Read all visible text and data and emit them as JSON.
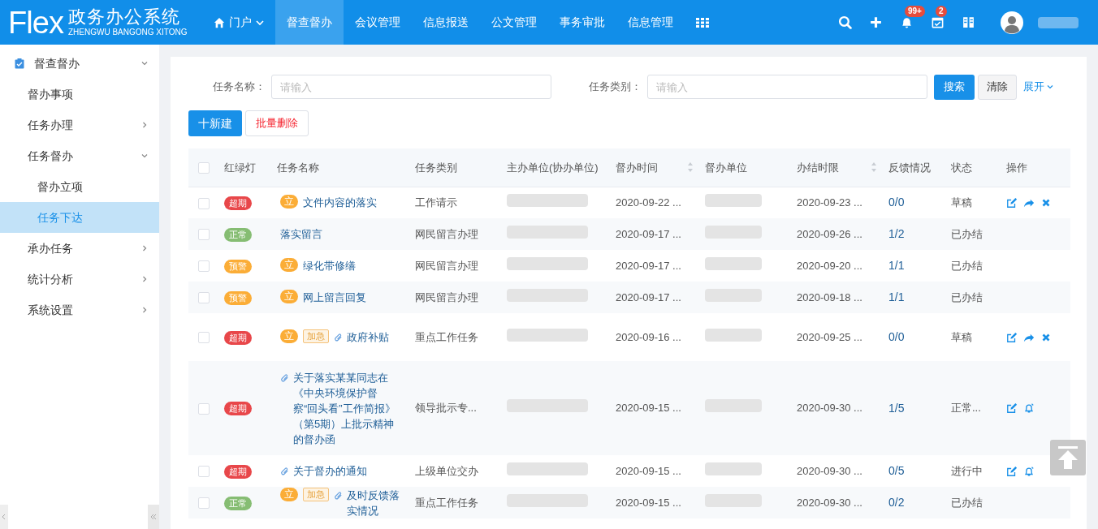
{
  "header": {
    "logo": "Flex",
    "app_title": "政务办公系统",
    "app_subtitle": "ZHENGWU BANGONG XITONG",
    "nav": [
      {
        "label": "门户",
        "kind": "home",
        "selected": false
      },
      {
        "label": "督查督办",
        "kind": "plain",
        "selected": true
      },
      {
        "label": "会议管理",
        "kind": "plain",
        "selected": false
      },
      {
        "label": "信息报送",
        "kind": "plain",
        "selected": false
      },
      {
        "label": "公文管理",
        "kind": "plain",
        "selected": false
      },
      {
        "label": "事务审批",
        "kind": "plain",
        "selected": false
      },
      {
        "label": "信息管理",
        "kind": "plain",
        "selected": false
      },
      {
        "kind": "grid",
        "selected": false
      }
    ],
    "tools": [
      {
        "kind": "search"
      },
      {
        "kind": "plus"
      },
      {
        "kind": "bell",
        "badge": "99+"
      },
      {
        "kind": "calendar",
        "badge": "2"
      },
      {
        "kind": "book"
      }
    ]
  },
  "sidebar": {
    "items": [
      {
        "label": "督查督办",
        "kind": "section",
        "expanded": true,
        "selected": false,
        "children": [
          {
            "label": "督办事项",
            "kind": "leaf",
            "selected": false
          },
          {
            "label": "任务办理",
            "kind": "group",
            "expanded": false,
            "selected": false
          },
          {
            "label": "任务督办",
            "kind": "group",
            "expanded": true,
            "selected": false,
            "children": [
              {
                "label": "督办立项",
                "kind": "leaf",
                "selected": false
              },
              {
                "label": "任务下达",
                "kind": "leaf",
                "selected": true
              }
            ]
          },
          {
            "label": "承办任务",
            "kind": "group",
            "expanded": false,
            "selected": false
          },
          {
            "label": "统计分析",
            "kind": "group",
            "expanded": false,
            "selected": false
          },
          {
            "label": "系统设置",
            "kind": "group",
            "expanded": false,
            "selected": false
          }
        ]
      }
    ]
  },
  "filters": [
    {
      "label": "任务名称：",
      "placeholder": "请输入"
    },
    {
      "label": "任务类别：",
      "placeholder": "请输入"
    }
  ],
  "filter_buttons": {
    "search": "搜索",
    "clear": "清除",
    "expand": "展开"
  },
  "actions": {
    "create": "十新建",
    "batch_delete": "批量删除"
  },
  "table": {
    "all_checked": false,
    "columns": [
      {
        "label": "红绿灯",
        "sortable": false
      },
      {
        "label": "任务名称",
        "sortable": false
      },
      {
        "label": "任务类别",
        "sortable": false
      },
      {
        "label": "主办单位(协办单位)",
        "sortable": false
      },
      {
        "label": "督办时间",
        "sortable": true
      },
      {
        "label": "督办单位",
        "sortable": false
      },
      {
        "label": "办结时限",
        "sortable": true
      },
      {
        "label": "反馈情况",
        "sortable": false
      },
      {
        "label": "状态",
        "sortable": false
      },
      {
        "label": "操作",
        "sortable": false
      }
    ],
    "rows": [
      {
        "checked": false,
        "light": {
          "kind": "overdue",
          "label": "超期"
        },
        "tag": "立",
        "urgent": null,
        "attachment": false,
        "name": "文件内容的落实",
        "category": "工作请示",
        "start": "2020-09-22 ...",
        "deadline": "2020-09-23 ...",
        "feedback": "0/0",
        "status": "草稿",
        "actions": [
          {
            "kind": "edit"
          },
          {
            "kind": "forward"
          },
          {
            "kind": "delete"
          }
        ]
      },
      {
        "checked": false,
        "light": {
          "kind": "normal",
          "label": "正常"
        },
        "tag": null,
        "urgent": null,
        "attachment": false,
        "name": "落实留言",
        "category": "网民留言办理",
        "start": "2020-09-17 ...",
        "deadline": "2020-09-26 ...",
        "feedback": "1/2",
        "status": "已办结",
        "actions": []
      },
      {
        "checked": false,
        "light": {
          "kind": "warning",
          "label": "预警"
        },
        "tag": "立",
        "urgent": null,
        "attachment": false,
        "name": "绿化带修缮",
        "category": "网民留言办理",
        "start": "2020-09-17 ...",
        "deadline": "2020-09-20 ...",
        "feedback": "1/1",
        "status": "已办结",
        "actions": []
      },
      {
        "checked": false,
        "light": {
          "kind": "warning",
          "label": "预警"
        },
        "tag": "立",
        "urgent": null,
        "attachment": false,
        "name": "网上留言回复",
        "category": "网民留言办理",
        "start": "2020-09-17 ...",
        "deadline": "2020-09-18 ...",
        "feedback": "1/1",
        "status": "已办结",
        "actions": []
      },
      {
        "checked": false,
        "light": {
          "kind": "overdue",
          "label": "超期"
        },
        "tag": "立",
        "urgent": "加急",
        "attachment": true,
        "name": "政府补贴",
        "category": "重点工作任务",
        "start": "2020-09-16 ...",
        "deadline": "2020-09-25 ...",
        "feedback": "0/0",
        "status": "草稿",
        "actions": [
          {
            "kind": "edit"
          },
          {
            "kind": "forward"
          },
          {
            "kind": "delete"
          }
        ]
      },
      {
        "checked": false,
        "light": {
          "kind": "overdue",
          "label": "超期"
        },
        "tag": null,
        "urgent": null,
        "attachment": true,
        "name": "关于落实某某同志在《中央环境保护督察“回头看”工作简报》（第5期）上批示精神的督办函",
        "category": "领导批示专...",
        "start": "2020-09-15 ...",
        "deadline": "2020-09-30 ...",
        "feedback": "1/5",
        "status": "正常...",
        "actions": [
          {
            "kind": "edit"
          },
          {
            "kind": "remind"
          }
        ]
      },
      {
        "checked": false,
        "light": {
          "kind": "overdue",
          "label": "超期"
        },
        "tag": null,
        "urgent": null,
        "attachment": true,
        "name": "关于督办的通知",
        "category": "上级单位交办",
        "start": "2020-09-15 ...",
        "deadline": "2020-09-30 ...",
        "feedback": "0/5",
        "status": "进行中",
        "actions": [
          {
            "kind": "edit"
          },
          {
            "kind": "remind"
          }
        ]
      },
      {
        "checked": false,
        "light": {
          "kind": "normal",
          "label": "正常"
        },
        "tag": "立",
        "urgent": "加急",
        "attachment": true,
        "name": "及时反馈落实情况",
        "category": "重点工作任务",
        "start": "2020-09-15 ...",
        "deadline": "2020-09-30 ...",
        "feedback": "0/2",
        "status": "已办结",
        "actions": []
      }
    ]
  }
}
